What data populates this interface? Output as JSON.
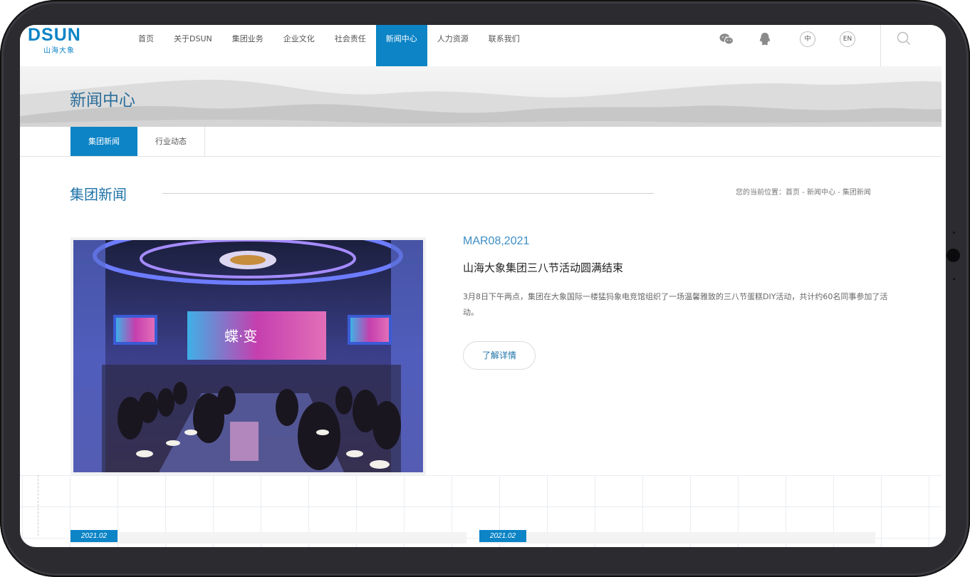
{
  "header": {
    "logo_text": "DSUN",
    "logo_sub": "山海大象",
    "nav": [
      {
        "label": "首页"
      },
      {
        "label": "关于DSUN"
      },
      {
        "label": "集团业务"
      },
      {
        "label": "企业文化"
      },
      {
        "label": "社会责任"
      },
      {
        "label": "新闻中心",
        "active": true
      },
      {
        "label": "人力资源"
      },
      {
        "label": "联系我们"
      }
    ],
    "icons": [
      "wechat-icon",
      "qq-icon",
      "search-icon"
    ],
    "lang_cn": "中",
    "lang_en": "EN"
  },
  "banner": {
    "title": "新闻中心"
  },
  "subtabs": [
    {
      "label": "集团新闻",
      "active": true
    },
    {
      "label": "行业动态"
    }
  ],
  "section": {
    "title": "集团新闻",
    "breadcrumb": "您的当前位置：首页 - 新闻中心 - 集团新闻"
  },
  "article": {
    "date": "MAR08,2021",
    "title": "山海大象集团三八节活动圆满结束",
    "summary": "3月8日下午两点，集团在大象国际一楼猛犸象电竞馆组织了一场温馨雅致的三八节蛋糕DIY活动，共计约60名同事参加了活动。",
    "more_label": "了解详情",
    "image_screen_text": "蝶·变"
  },
  "list": [
    {
      "date": "2021.02"
    },
    {
      "date": "2021.02"
    }
  ],
  "colors": {
    "accent": "#0c84c6",
    "title_blue": "#1d73a8",
    "frame": "#2b2b30"
  }
}
